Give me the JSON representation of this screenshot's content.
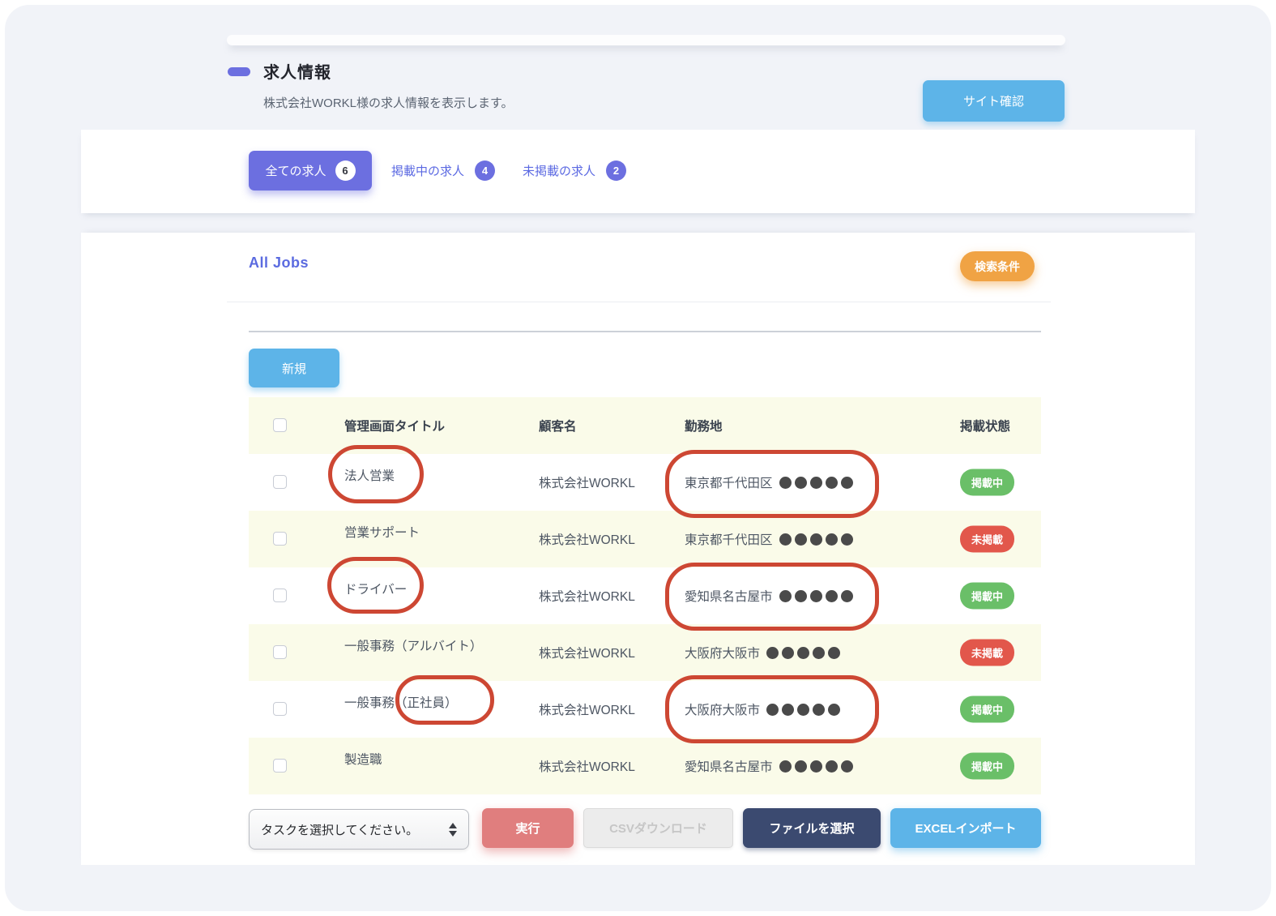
{
  "page": {
    "title": "求人情報",
    "subtitle": "株式会社WORKL様の求人情報を表示します。",
    "site_check_button": "サイト確認"
  },
  "tabs": [
    {
      "label": "全ての求人",
      "count": "6",
      "active": true
    },
    {
      "label": "掲載中の求人",
      "count": "4",
      "active": false
    },
    {
      "label": "未掲載の求人",
      "count": "2",
      "active": false
    }
  ],
  "panel": {
    "heading": "All Jobs",
    "search_button": "検索条件",
    "new_button": "新規"
  },
  "table": {
    "columns": [
      "管理画面タイトル",
      "顧客名",
      "勤務地",
      "掲載状態"
    ],
    "rows": [
      {
        "title": "法人営業",
        "customer": "株式会社WORKL",
        "location": "東京都千代田区",
        "masked_dots": 5,
        "status": "掲載中",
        "status_type": "published"
      },
      {
        "title": "営業サポート",
        "customer": "株式会社WORKL",
        "location": "東京都千代田区",
        "masked_dots": 5,
        "status": "未掲載",
        "status_type": "unpublished"
      },
      {
        "title": "ドライバー",
        "customer": "株式会社WORKL",
        "location": "愛知県名古屋市",
        "masked_dots": 5,
        "status": "掲載中",
        "status_type": "published"
      },
      {
        "title": "一般事務（アルバイト）",
        "customer": "株式会社WORKL",
        "location": "大阪府大阪市",
        "masked_dots": 5,
        "status": "未掲載",
        "status_type": "unpublished"
      },
      {
        "title": "一般事務（正社員）",
        "customer": "株式会社WORKL",
        "location": "大阪府大阪市",
        "masked_dots": 5,
        "status": "掲載中",
        "status_type": "published"
      },
      {
        "title": "製造職",
        "customer": "株式会社WORKL",
        "location": "愛知県名古屋市",
        "masked_dots": 5,
        "status": "掲載中",
        "status_type": "published"
      }
    ]
  },
  "actions": {
    "task_select_value": "タスクを選択してください。",
    "execute_button": "実行",
    "csv_button": "CSVダウンロード",
    "file_button": "ファイルを選択",
    "excel_button": "EXCELインポート"
  },
  "annotations": {
    "circled_items": [
      "法人営業",
      "東京都千代田区●●●●●（1行目）",
      "ドライバー",
      "愛知県名古屋市●●●●●（3行目）",
      "（正社員）",
      "大阪府大阪市●●●●●（5行目）"
    ]
  },
  "colors": {
    "accent_purple": "#6c6fe0",
    "accent_blue": "#5db4e8",
    "accent_orange": "#f0a344",
    "published": "#6abf68",
    "unpublished": "#e2574b",
    "execute_red": "#e07e7e",
    "file_navy": "#3b4a70",
    "annotation": "#cd4733",
    "row_highlight": "#fafbe9"
  }
}
